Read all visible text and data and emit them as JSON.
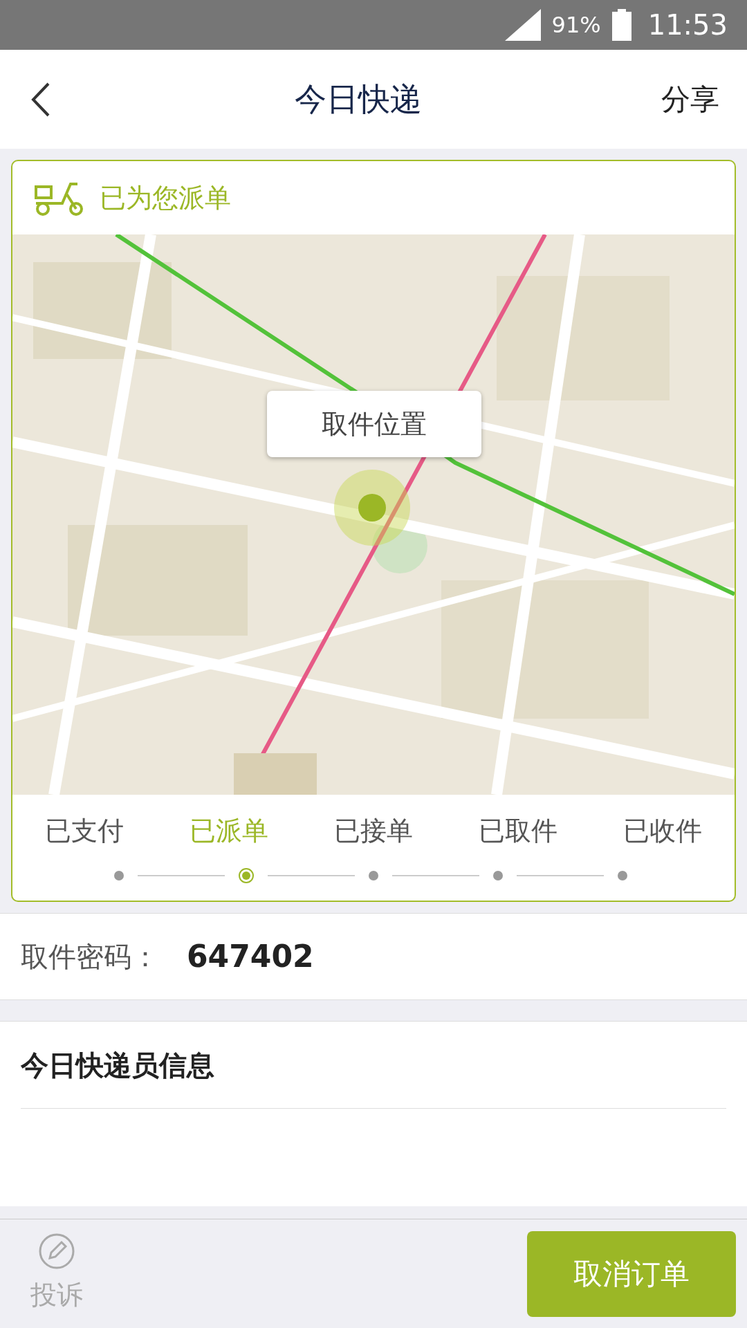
{
  "status_bar": {
    "battery": "91%",
    "time": "11:53"
  },
  "header": {
    "title": "今日快递",
    "action": "分享"
  },
  "order_card": {
    "status_title": "已为您派单",
    "map": {
      "kind": "picture",
      "callout": "取件位置"
    },
    "steps": [
      {
        "label": "已支付",
        "selected": false
      },
      {
        "label": "已派单",
        "selected": true
      },
      {
        "label": "已接单",
        "selected": false
      },
      {
        "label": "已取件",
        "selected": false
      },
      {
        "label": "已收件",
        "selected": false
      }
    ]
  },
  "pickup_code": {
    "label": "取件密码：",
    "value": "647402"
  },
  "courier_section": {
    "title": "今日快递员信息"
  },
  "bottom_bar": {
    "complaint": "投诉",
    "cancel_button": "取消订单"
  }
}
